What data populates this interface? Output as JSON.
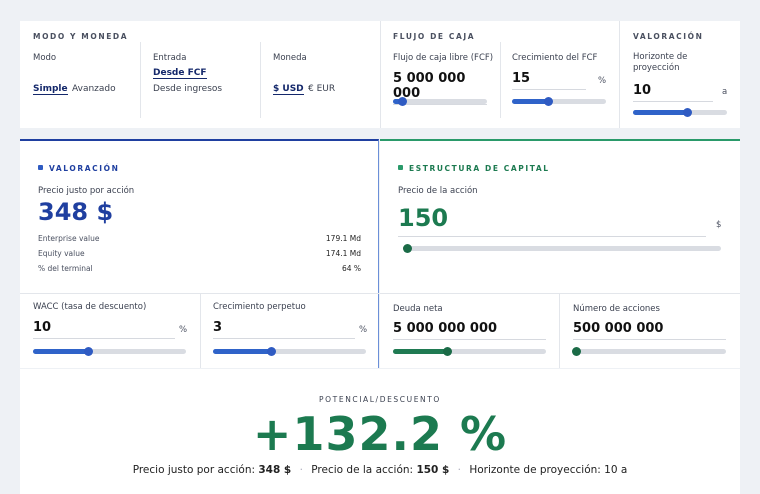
{
  "top": {
    "mode_section": {
      "title": "MODO Y MONEDA",
      "modo_label": "Modo",
      "modo_options": [
        "Simple",
        "Avanzado"
      ],
      "entrada_label": "Entrada",
      "entrada_options": [
        "Desde FCF",
        "Desde ingresos"
      ],
      "moneda_label": "Moneda",
      "moneda_options": [
        "$ USD",
        "€ EUR"
      ]
    },
    "cash_flow": {
      "title": "FLUJO DE CAJA",
      "fcf_label": "Flujo de caja libre (FCF)",
      "fcf_value": "5 000 000 000",
      "fcf_slider": 0.1,
      "growth_label": "Crecimiento del FCF",
      "growth_value": "15",
      "growth_unit": "%",
      "growth_slider": 0.38
    },
    "valuation_horizon": {
      "title": "VALORACIÓN",
      "horizon_label": "Horizonte de proyección",
      "horizon_value": "10",
      "horizon_unit": "a",
      "horizon_slider": 0.57
    }
  },
  "valuation": {
    "title": "VALORACIÓN",
    "fair_price_label": "Precio justo por acción",
    "fair_price_value": "348 $",
    "rows": [
      {
        "label": "Enterprise value",
        "value": "179.1 Md"
      },
      {
        "label": "Equity value",
        "value": "174.1 Md"
      },
      {
        "label": "% del terminal",
        "value": "64 %"
      }
    ],
    "wacc_label": "WACC (tasa de descuento)",
    "wacc_value": "10",
    "wacc_unit": "%",
    "wacc_slider": 0.36,
    "perp_label": "Crecimiento perpetuo",
    "perp_value": "3",
    "perp_unit": "%",
    "perp_slider": 0.38
  },
  "capital": {
    "title": "ESTRUCTURA DE CAPITAL",
    "price_label": "Precio de la acción",
    "price_value": "150",
    "price_unit": "$",
    "price_slider": 0.0,
    "debt_label": "Deuda neta",
    "debt_value": "5 000 000 000",
    "debt_slider": 0.35,
    "shares_label": "Número de acciones",
    "shares_value": "500 000 000",
    "shares_slider": 0.02
  },
  "potential": {
    "title": "POTENCIAL/DESCUENTO",
    "value": "+132.2 %",
    "summary": [
      {
        "label": "Precio justo por acción:",
        "value": "348 $"
      },
      {
        "label": "Precio de la acción:",
        "value": "150 $"
      },
      {
        "label": "Horizonte de proyección:",
        "value": "10 a"
      }
    ]
  },
  "colors": {
    "accent_blue": "#1f3fa0",
    "accent_green": "#1c7a50",
    "slider_blue": "#2f63c9"
  }
}
